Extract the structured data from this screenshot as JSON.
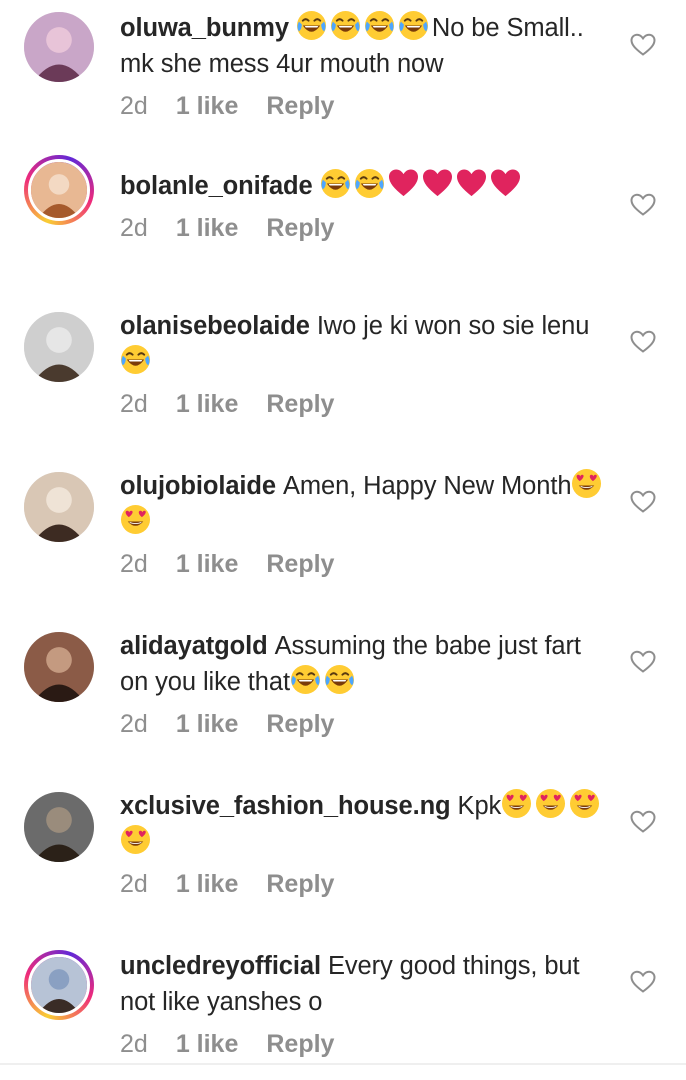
{
  "comments": [
    {
      "username": "oluwa_bunmy",
      "text_before": "",
      "emojis_before": [
        "joy",
        "joy",
        "joy",
        "joy"
      ],
      "text": "No be Small.. mk she mess 4ur mouth now",
      "emojis_after": [],
      "time": "2d",
      "likes": "1 like",
      "reply": "Reply",
      "avatar_ring": false
    },
    {
      "username": "bolanle_onifade",
      "emojis_before": [
        "joy",
        "joy",
        "heart",
        "heart",
        "heart",
        "heart"
      ],
      "text": "",
      "emojis_after": [],
      "time": "2d",
      "likes": "1 like",
      "reply": "Reply",
      "avatar_ring": true
    },
    {
      "username": "olanisebeolaide",
      "emojis_before": [],
      "text": "Iwo je ki won so sie lenu",
      "emojis_after": [
        "joy"
      ],
      "time": "2d",
      "likes": "1 like",
      "reply": "Reply",
      "avatar_ring": false
    },
    {
      "username": "olujobiolaide",
      "emojis_before": [],
      "text": "Amen, Happy New Month",
      "emojis_after": [
        "heart_eyes",
        "heart_eyes"
      ],
      "time": "2d",
      "likes": "1 like",
      "reply": "Reply",
      "avatar_ring": false
    },
    {
      "username": "alidayatgold",
      "emojis_before": [],
      "text": "Assuming the babe just fart on you like that",
      "emojis_after": [
        "joy",
        "joy"
      ],
      "time": "2d",
      "likes": "1 like",
      "reply": "Reply",
      "avatar_ring": false
    },
    {
      "username": "xclusive_fashion_house.ng",
      "emojis_before": [],
      "text": "Kpk",
      "emojis_after": [
        "heart_eyes",
        "heart_eyes",
        "heart_eyes",
        "heart_eyes"
      ],
      "time": "2d",
      "likes": "1 like",
      "reply": "Reply",
      "avatar_ring": false
    },
    {
      "username": "uncledreyofficial",
      "emojis_before": [],
      "text": "Every good things, but not like yanshes o",
      "emojis_after": [],
      "time": "2d",
      "likes": "1 like",
      "reply": "Reply",
      "avatar_ring": true
    }
  ],
  "colors": {
    "text": "#262626",
    "meta": "#8e8e8e",
    "heart_outline": "#8e8e8e",
    "heart_emoji": "#e0245e"
  },
  "icons": {
    "like": "heart-outline-icon",
    "emoji_joy": "face-with-tears-of-joy",
    "emoji_heart": "red-heart",
    "emoji_heart_eyes": "smiling-face-with-heart-eyes"
  }
}
